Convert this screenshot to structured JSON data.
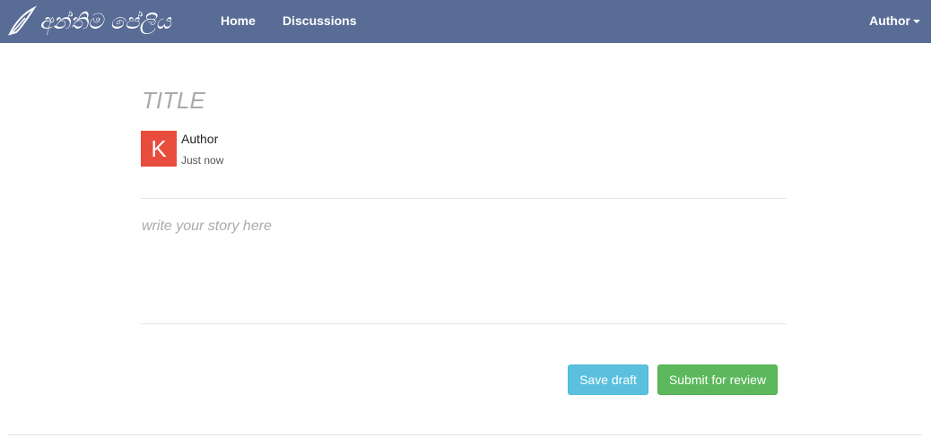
{
  "navbar": {
    "brand": "අන්තිම පේලිය",
    "links": [
      {
        "label": "Home"
      },
      {
        "label": "Discussions"
      }
    ],
    "user_menu": {
      "label": "Author"
    }
  },
  "story": {
    "title_placeholder": "TITLE",
    "author": {
      "initial": "K",
      "name": "Author",
      "time": "Just now",
      "avatar_color": "#e74c3c"
    },
    "body_placeholder": "write your story here"
  },
  "actions": {
    "save_draft": "Save draft",
    "submit": "Submit for review"
  },
  "colors": {
    "navbar": "#586c95",
    "info_button": "#5bc0de",
    "success_button": "#5cb85c"
  }
}
